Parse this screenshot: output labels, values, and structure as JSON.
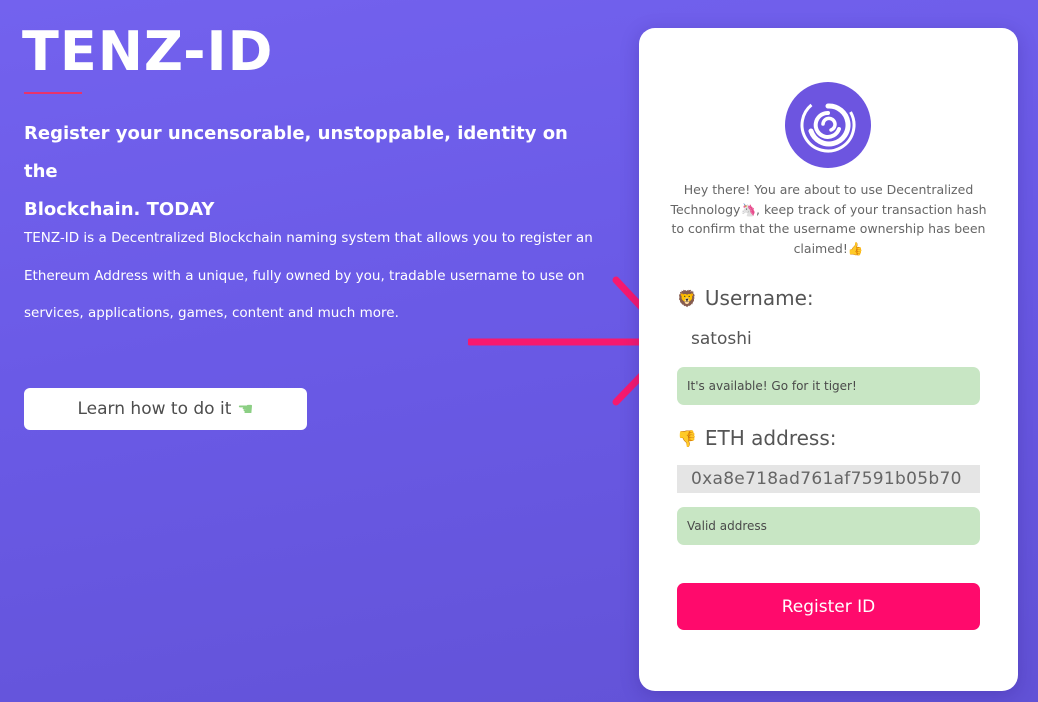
{
  "hero": {
    "brand": "TENZ-ID",
    "tagline_line1": "Register your uncensorable, unstoppable, identity on the",
    "tagline_line2": "Blockchain. TODAY",
    "description": "TENZ-ID is a Decentralized Blockchain naming system that allows you to register an Ethereum Address with a unique, fully owned by you, tradable username to use on services, applications, games, content and much more.",
    "learn_button": "Learn how to do it",
    "learn_button_icon": "pointing-hand-icon"
  },
  "card": {
    "logo_icon": "swirl-logo-icon",
    "intro": "Hey there! You are about to use Decentralized Technology🦄, keep track of your transaction hash to confirm that the username ownership has been claimed!👍",
    "username": {
      "emoji": "🦁",
      "label": "Username:",
      "value": "satoshi",
      "status": "It's available! Go for it tiger!"
    },
    "eth": {
      "emoji": "👎",
      "label": "ETH address:",
      "value": "0xa8e718ad761af7591b05b70",
      "status": "Valid address"
    },
    "register_button": "Register ID"
  },
  "colors": {
    "background": "#6d5cea",
    "accent_pink": "#ff0a6c",
    "success_green": "#c8e6c4",
    "logo_purple": "#6d55e0"
  }
}
